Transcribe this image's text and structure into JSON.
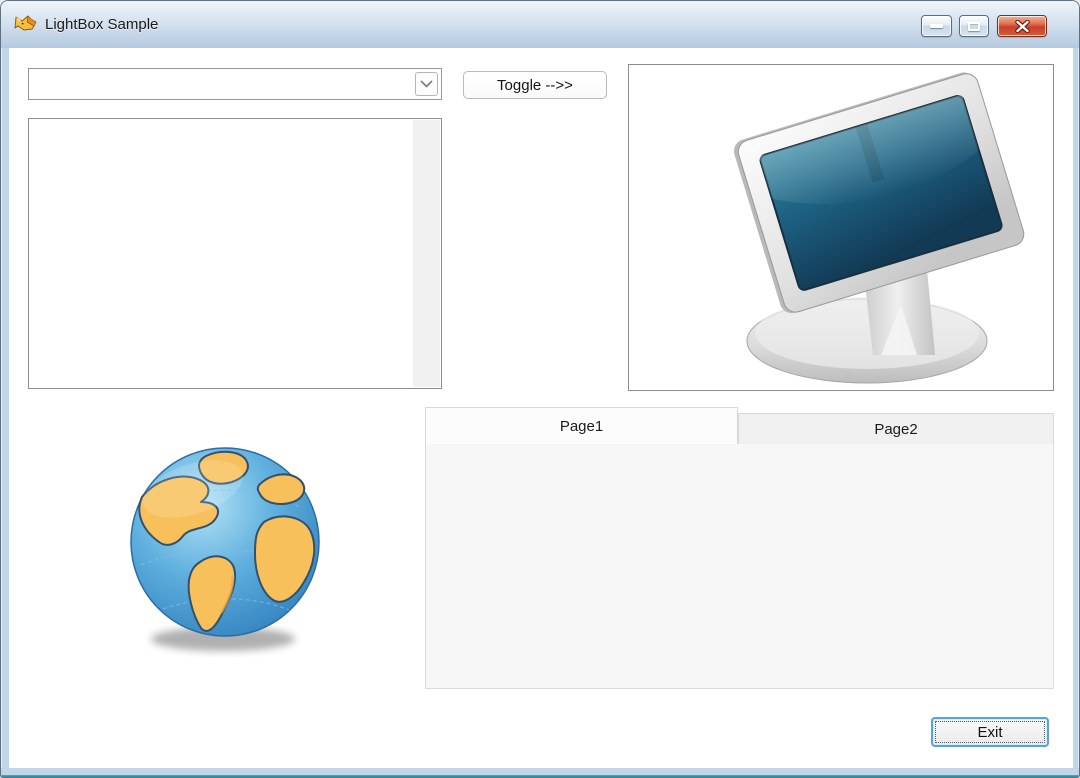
{
  "window": {
    "title": "LightBox Sample",
    "title_icon": "fox-icon",
    "controls": {
      "minimize_icon": "minimize-icon",
      "maximize_icon": "maximize-icon",
      "close_icon": "close-icon"
    }
  },
  "main": {
    "combo": {
      "value": "",
      "dropdown_icon": "chevron-down-icon"
    },
    "toggle_button": {
      "label": "Toggle -->>"
    },
    "listbox": {
      "items": [],
      "scrollbar": "vertical-scrollbar-empty"
    },
    "monitor_image": {
      "alt": "computer-monitor-illustration"
    },
    "globe_image": {
      "alt": "earth-globe-illustration"
    },
    "tabs": {
      "items": [
        {
          "label": "Page1",
          "active": true
        },
        {
          "label": "Page2",
          "active": false
        }
      ]
    },
    "exit_button": {
      "label": "Exit"
    }
  },
  "colors": {
    "titlebar_top": "#f0f5fa",
    "titlebar_bottom": "#b2c8de",
    "frame_blue": "#c2d6e9",
    "bottom_edge_teal": "#0a6a7d",
    "close_button_red": "#c8402a",
    "monitor_screen_teal": "#1b5a77",
    "ocean_blue": "#2a79b9",
    "continent_orange": "#f8c05a"
  }
}
